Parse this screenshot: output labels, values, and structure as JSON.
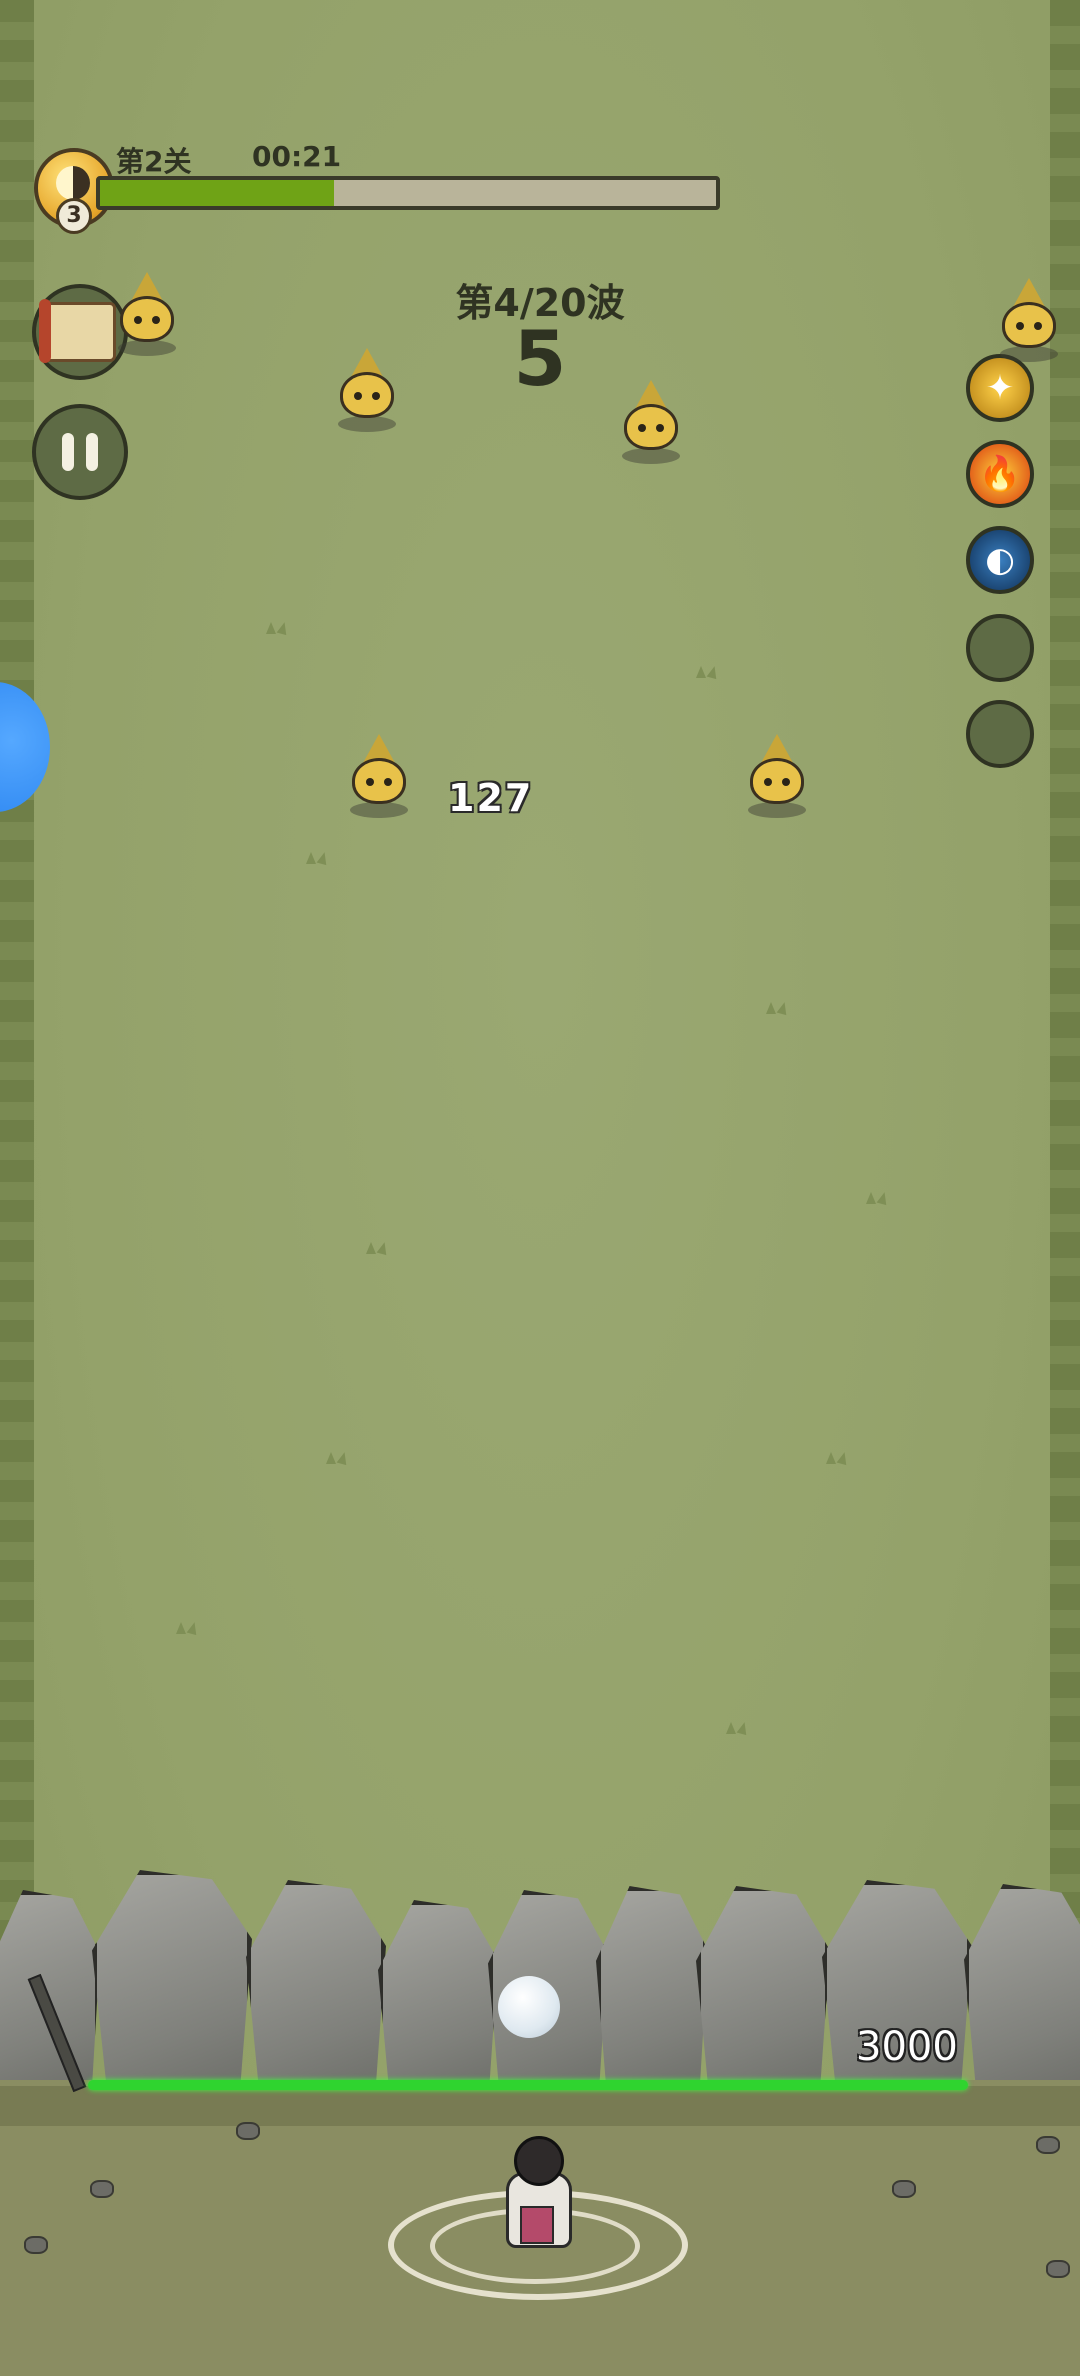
{
  "hud": {
    "stage": "第2关",
    "timer": "00:21",
    "player_level": "3",
    "stage_progress": 0.38
  },
  "wave": {
    "label": "第4/20波",
    "countdown": "5"
  },
  "combat": {
    "damage_number": "127",
    "wall_hp": "3000",
    "wall_hp_fraction": 1.0
  },
  "buttons": {
    "map": "map-scroll-icon",
    "pause": "pause-icon"
  },
  "skills": [
    {
      "name": "wind-bird-icon",
      "color": "#e7b21f"
    },
    {
      "name": "fire-icon",
      "color": "#e04a16"
    },
    {
      "name": "water-orb-icon",
      "color": "#1e5f9a"
    },
    {
      "name": "empty-slot",
      "color": "#5e6b45"
    },
    {
      "name": "empty-slot",
      "color": "#5e6b45"
    }
  ]
}
